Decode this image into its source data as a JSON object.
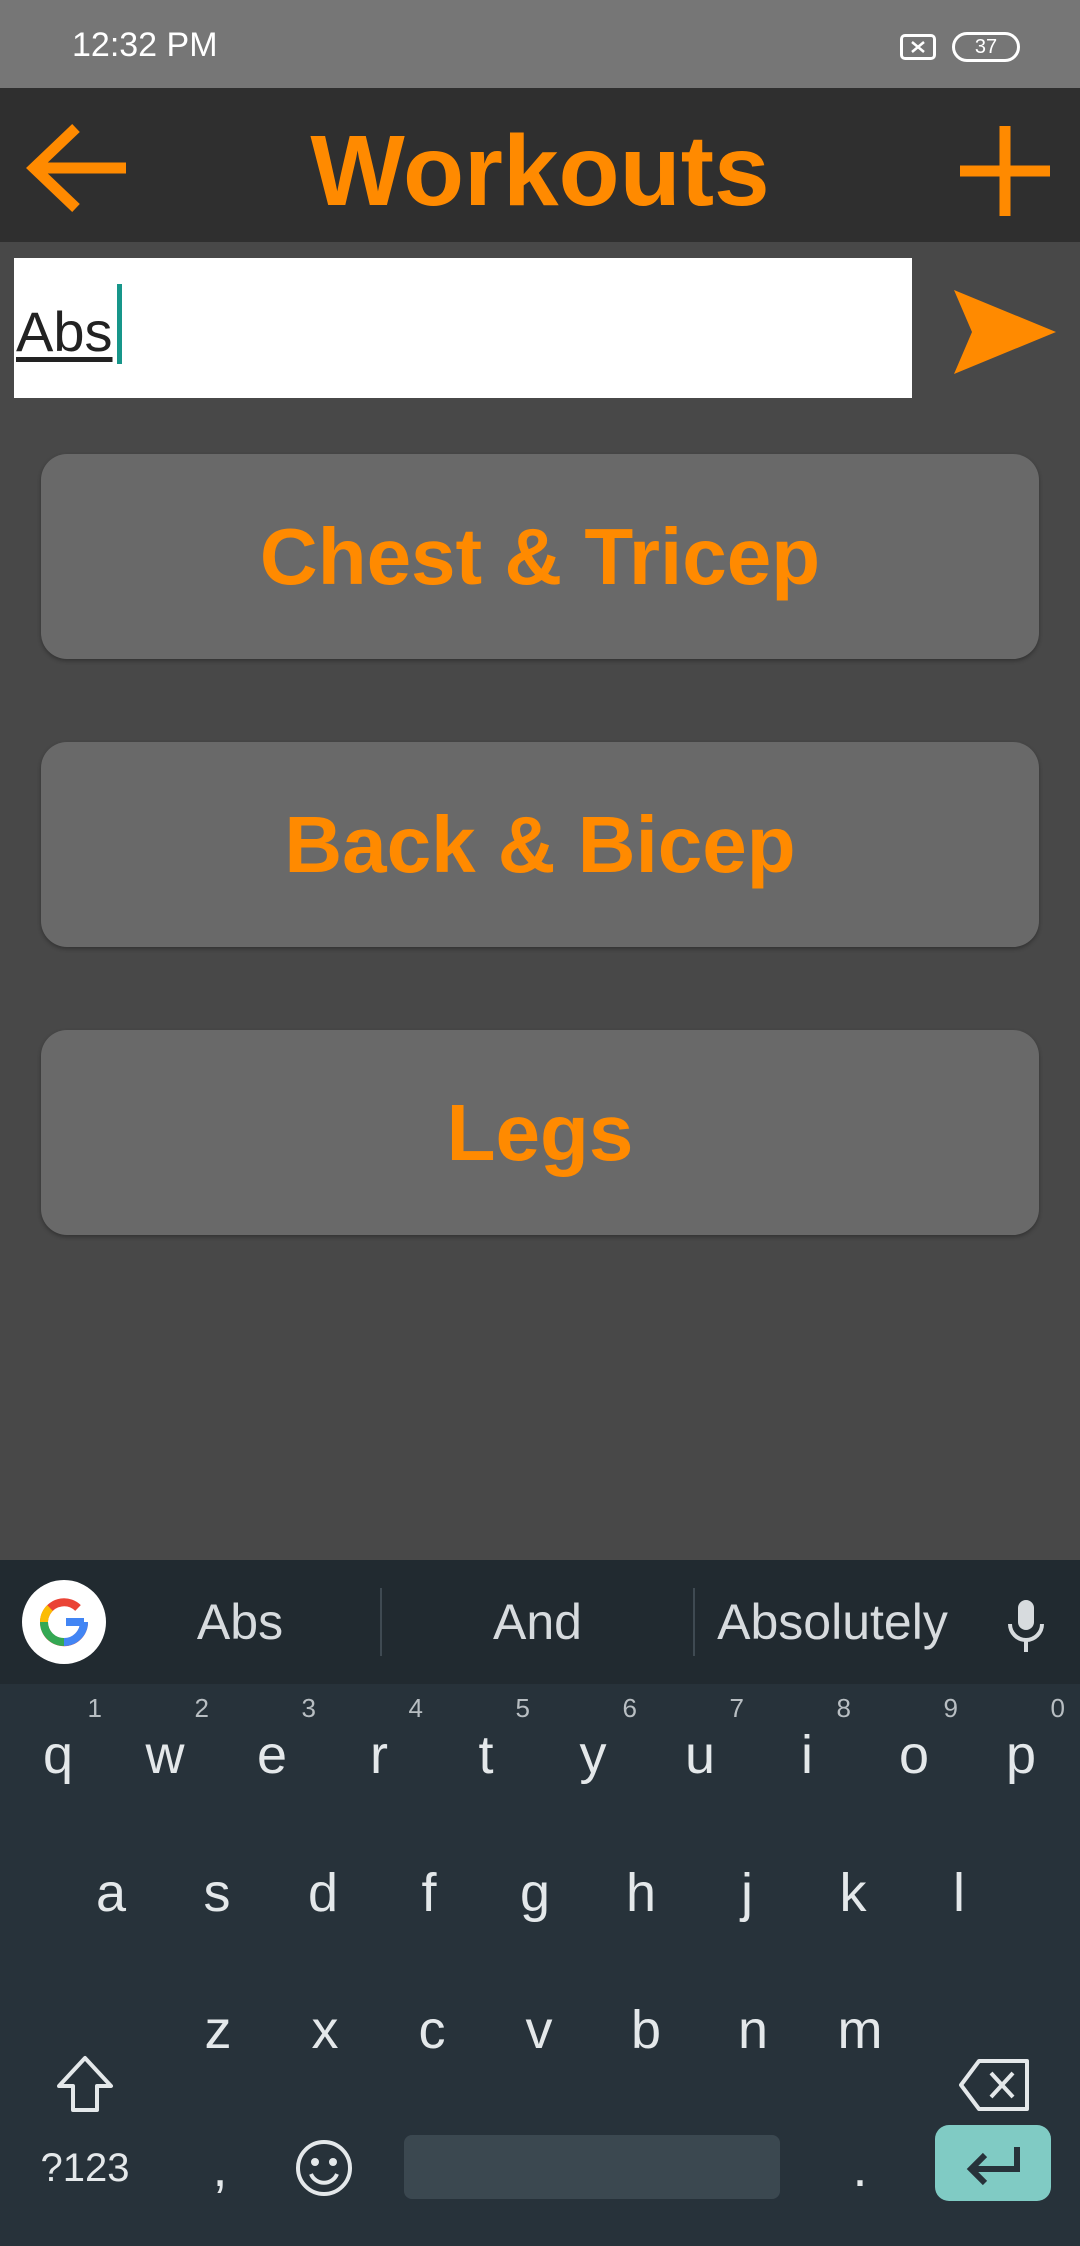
{
  "status_bar": {
    "time": "12:32 PM",
    "battery": "37"
  },
  "app_bar": {
    "title": "Workouts",
    "back_icon": "arrow-left-icon",
    "add_icon": "plus-icon"
  },
  "input": {
    "value": "Abs",
    "send_icon": "send-icon"
  },
  "workouts": [
    {
      "label": "Chest & Tricep"
    },
    {
      "label": "Back & Bicep"
    },
    {
      "label": "Legs"
    }
  ],
  "colors": {
    "accent": "#ff8a00",
    "background": "#484848",
    "app_bar": "#2f2f2f",
    "button": "#696969",
    "keyboard": "#27323a",
    "enter": "#80cbc4"
  },
  "keyboard": {
    "suggestions": [
      "Abs",
      "And",
      "Absolutely"
    ],
    "row1": [
      {
        "k": "q",
        "n": "1"
      },
      {
        "k": "w",
        "n": "2"
      },
      {
        "k": "e",
        "n": "3"
      },
      {
        "k": "r",
        "n": "4"
      },
      {
        "k": "t",
        "n": "5"
      },
      {
        "k": "y",
        "n": "6"
      },
      {
        "k": "u",
        "n": "7"
      },
      {
        "k": "i",
        "n": "8"
      },
      {
        "k": "o",
        "n": "9"
      },
      {
        "k": "p",
        "n": "0"
      }
    ],
    "row2": [
      "a",
      "s",
      "d",
      "f",
      "g",
      "h",
      "j",
      "k",
      "l"
    ],
    "row3": [
      "z",
      "x",
      "c",
      "v",
      "b",
      "n",
      "m"
    ],
    "bottom": {
      "symbols": "?123",
      "comma": ",",
      "period": "."
    }
  }
}
